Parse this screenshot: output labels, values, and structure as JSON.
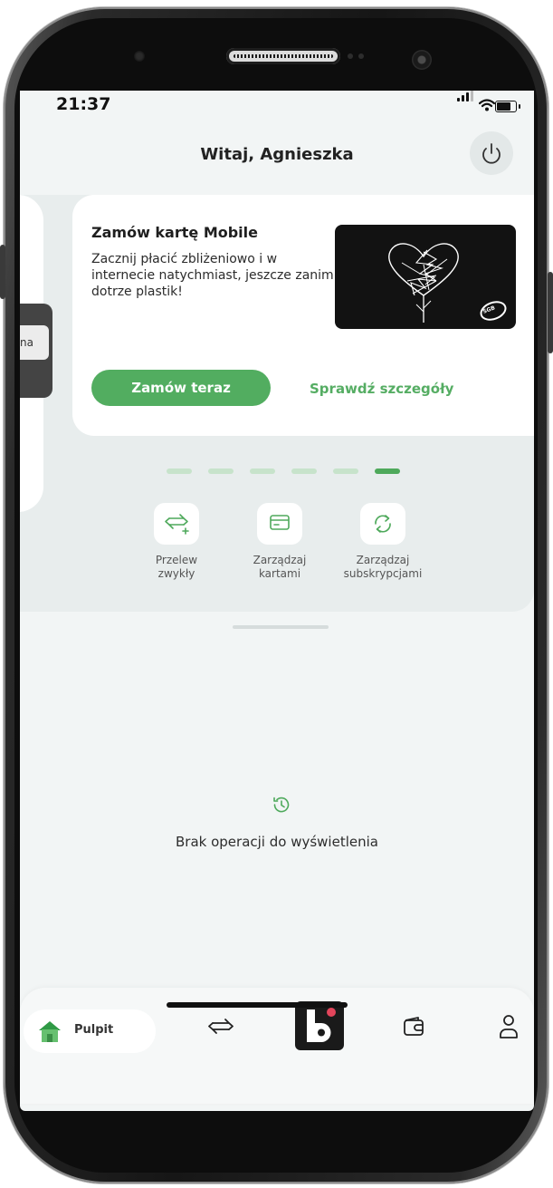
{
  "status_bar": {
    "time": "21:37",
    "battery_level": 0.85
  },
  "header": {
    "greeting": "Witaj, Agnieszka"
  },
  "side_tab": {
    "label": "na"
  },
  "promo": {
    "title": "Zamów kartę Mobile",
    "description": "Zacznij płacić zbliżeniowo i w internecie natychmiast, jeszcze zanim dotrze plastik!",
    "primary_button": "Zamów teraz",
    "secondary_link": "Sprawdź szczegóły",
    "card_logo": "SGB"
  },
  "carousel": {
    "total": 6,
    "active_index": 5
  },
  "quick_actions": [
    {
      "label": "Przelew\nzwykły",
      "icon": "transfer-plus-icon"
    },
    {
      "label": "Zarządzaj\nkartami",
      "icon": "card-icon"
    },
    {
      "label": "Zarządzaj\nsubskrypcjami",
      "icon": "refresh-icon"
    }
  ],
  "operations": {
    "empty_message": "Brak operacji do wyświetlenia"
  },
  "bottom_nav": {
    "home_label": "Pulpit",
    "items": [
      "home-icon",
      "transfer-icon",
      "bank-logo",
      "wallet-icon",
      "profile-icon"
    ]
  },
  "colors": {
    "accent": "#52ad60",
    "background": "#f2f5f5",
    "panel": "#e8eded"
  }
}
